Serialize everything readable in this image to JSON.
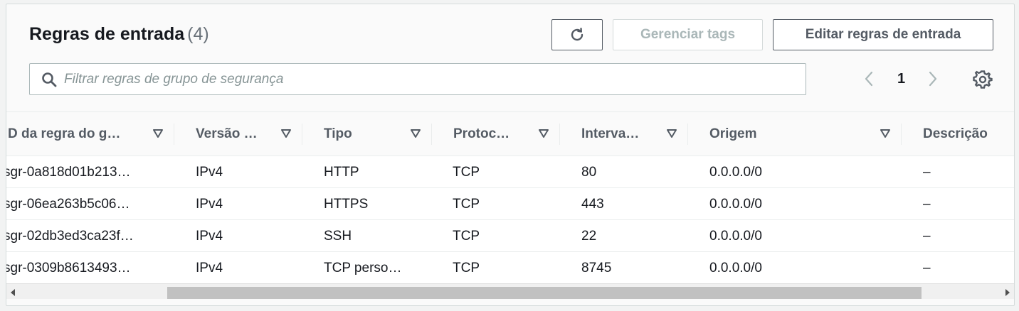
{
  "header": {
    "title": "Regras de entrada",
    "count": "(4)",
    "manage_tags_label": "Gerenciar tags",
    "edit_rules_label": "Editar regras de entrada"
  },
  "search": {
    "placeholder": "Filtrar regras de grupo de segurança"
  },
  "pagination": {
    "current_page": "1"
  },
  "columns": [
    {
      "label": "D da regra do g…"
    },
    {
      "label": "Versão …"
    },
    {
      "label": "Tipo"
    },
    {
      "label": "Protoc…"
    },
    {
      "label": "Interva…"
    },
    {
      "label": "Origem"
    },
    {
      "label": "Descrição"
    }
  ],
  "rows": [
    {
      "id": "sgr-0a818d01b213…",
      "version": "IPv4",
      "type": "HTTP",
      "protocol": "TCP",
      "range": "80",
      "origin": "0.0.0.0/0",
      "description": "–"
    },
    {
      "id": "sgr-06ea263b5c06…",
      "version": "IPv4",
      "type": "HTTPS",
      "protocol": "TCP",
      "range": "443",
      "origin": "0.0.0.0/0",
      "description": "–"
    },
    {
      "id": "sgr-02db3ed3ca23f…",
      "version": "IPv4",
      "type": "SSH",
      "protocol": "TCP",
      "range": "22",
      "origin": "0.0.0.0/0",
      "description": "–"
    },
    {
      "id": "sgr-0309b8613493…",
      "version": "IPv4",
      "type": "TCP perso…",
      "protocol": "TCP",
      "range": "8745",
      "origin": "0.0.0.0/0",
      "description": "–"
    }
  ],
  "icons": {
    "refresh": "refresh-icon",
    "search": "search-icon",
    "prev": "chevron-left-icon",
    "next": "chevron-right-icon",
    "settings": "gear-icon",
    "sort": "caret-down-icon"
  }
}
